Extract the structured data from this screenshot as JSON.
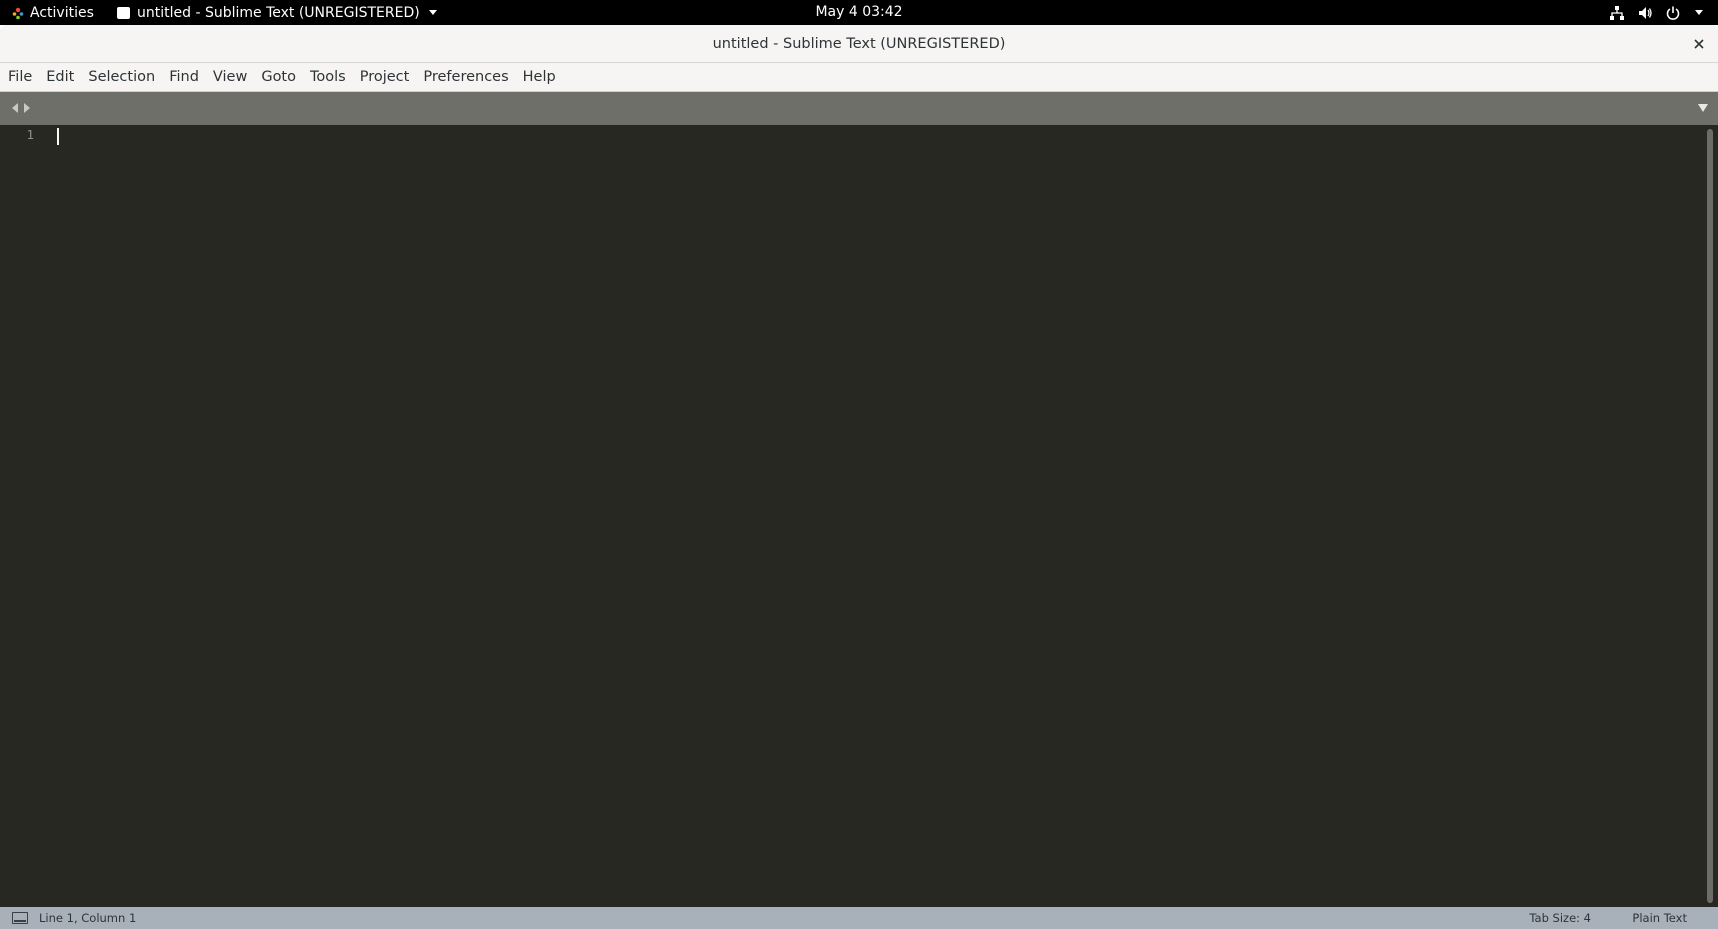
{
  "topbar": {
    "activities_label": "Activities",
    "app_menu_label": "untitled - Sublime Text (UNREGISTERED)",
    "clock": "May 4  03:42",
    "icons": [
      "network-icon",
      "volume-icon",
      "power-icon",
      "chevron-down-icon"
    ]
  },
  "window": {
    "title": "untitled - Sublime Text (UNREGISTERED)",
    "close_glyph": "×"
  },
  "menubar": {
    "items": [
      "File",
      "Edit",
      "Selection",
      "Find",
      "View",
      "Goto",
      "Tools",
      "Project",
      "Preferences",
      "Help"
    ]
  },
  "editor": {
    "line_numbers": [
      "1"
    ],
    "content": "",
    "colors": {
      "background": "#272822",
      "gutter_text": "#90908a",
      "tab_strip": "#6f6f69",
      "status_bar": "#a8b0b9"
    }
  },
  "statusbar": {
    "position": "Line 1, Column 1",
    "tab_size": "Tab Size: 4",
    "syntax": "Plain Text"
  }
}
